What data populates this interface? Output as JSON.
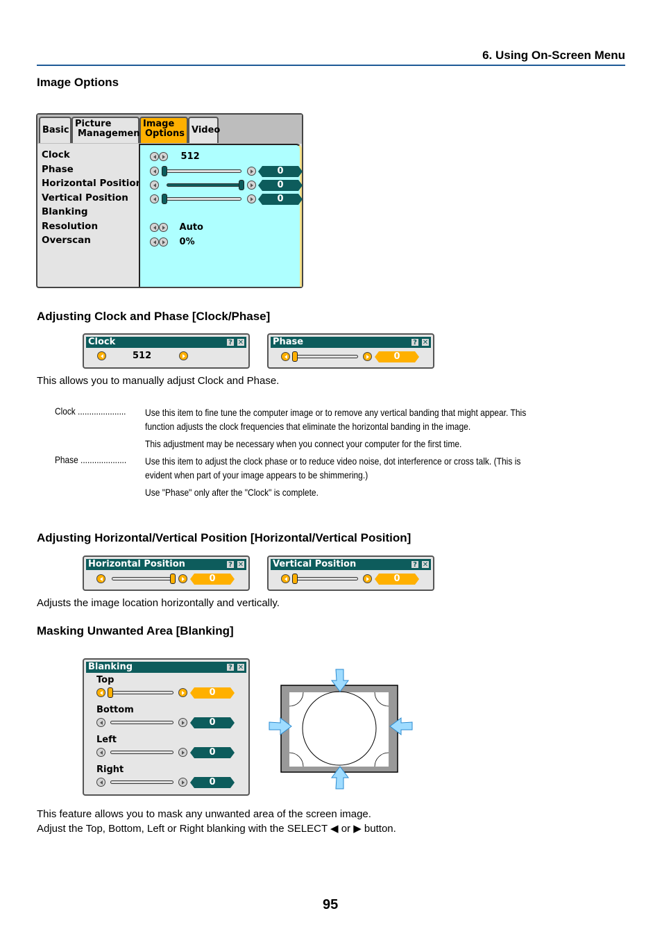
{
  "header": {
    "chapter": "6. Using On-Screen Menu",
    "page_number": "95"
  },
  "section_title": "Image Options",
  "main_menu": {
    "tabs": [
      {
        "label_line1": "Basic",
        "label_line2": "",
        "active": false
      },
      {
        "label_line1": "Picture",
        "label_line2": "Management",
        "active": false
      },
      {
        "label_line1": "Image",
        "label_line2": "Options",
        "active": true
      },
      {
        "label_line1": "Video",
        "label_line2": "",
        "active": false
      }
    ],
    "items": [
      {
        "label": "Clock",
        "value": "512",
        "type": "value"
      },
      {
        "label": "Phase",
        "value": "0",
        "type": "slider",
        "level": 0.0
      },
      {
        "label": "Horizontal Position",
        "value": "0",
        "type": "slider",
        "level": 1.0
      },
      {
        "label": "Vertical Position",
        "value": "0",
        "type": "slider",
        "level": 0.0
      },
      {
        "label": "Blanking",
        "value": "",
        "type": "none"
      },
      {
        "label": "Resolution",
        "value": "Auto",
        "type": "value"
      },
      {
        "label": "Overscan",
        "value": "0%",
        "type": "value"
      }
    ]
  },
  "clock_phase": {
    "heading": "Adjusting Clock and Phase [Clock/Phase]",
    "clock_dialog": {
      "title": "Clock",
      "value": "512"
    },
    "phase_dialog": {
      "title": "Phase",
      "value": "0",
      "level": 0.0
    },
    "intro": "This allows you to manually adjust Clock and Phase.",
    "definitions": [
      {
        "term": "Clock .....................",
        "lines": [
          "Use this item to fine tune the computer image or to remove any vertical banding that might appear. This",
          "function adjusts the clock frequencies that eliminate the horizontal banding in the image.",
          "This adjustment may be necessary when you connect your computer for the first time."
        ]
      },
      {
        "term": "Phase ....................",
        "lines": [
          "Use this item to adjust the clock phase or to reduce video noise, dot interference or cross talk. (This is",
          "evident when part of your image appears to be shimmering.)",
          "Use \"Phase\" only after the \"Clock\" is complete."
        ]
      }
    ]
  },
  "position": {
    "heading": "Adjusting Horizontal/Vertical Position [Horizontal/Vertical Position]",
    "horizontal_dialog": {
      "title": "Horizontal Position",
      "value": "0",
      "level": 1.0
    },
    "vertical_dialog": {
      "title": "Vertical Position",
      "value": "0",
      "level": 0.0
    },
    "text": "Adjusts the image location horizontally and vertically."
  },
  "blanking": {
    "heading": "Masking Unwanted Area [Blanking]",
    "dialog": {
      "title": "Blanking",
      "rows": [
        {
          "label": "Top",
          "value": "0",
          "level": 0.0,
          "selected": true
        },
        {
          "label": "Bottom",
          "value": "0",
          "level": 0.0,
          "selected": false
        },
        {
          "label": "Left",
          "value": "0",
          "level": 0.0,
          "selected": false
        },
        {
          "label": "Right",
          "value": "0",
          "level": 0.0,
          "selected": false
        }
      ]
    },
    "text_line1": "This feature allows you to mask any unwanted area of the screen image.",
    "text_line2": "Adjust the Top, Bottom, Left or Right blanking with the SELECT ◀ or ▶ button."
  },
  "dialog_buttons": {
    "help": "?",
    "close": "✕"
  },
  "colors": {
    "teal": "#0d5c5c",
    "orange": "#ffb000",
    "menu_bg": "#aeffff",
    "rule": "#1e5a96",
    "arrow": "#9fdcff"
  }
}
